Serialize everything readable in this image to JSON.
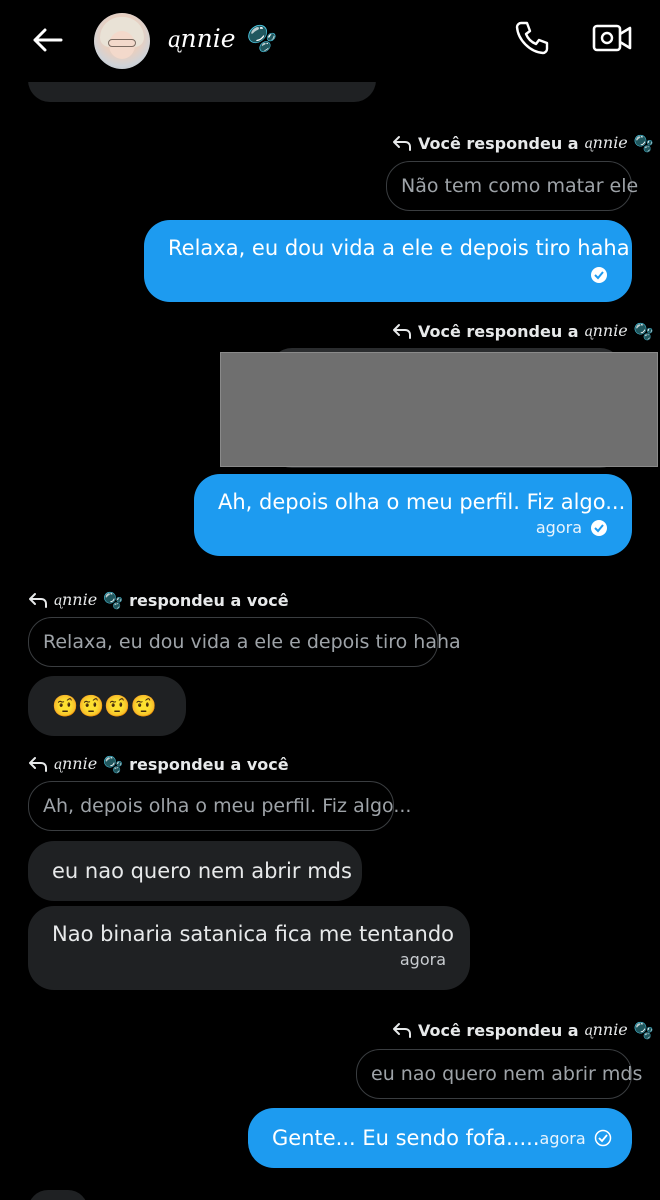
{
  "header": {
    "contact_name": "ᶏnnie",
    "contact_emoji": "🫧",
    "icons": [
      "back-arrow-icon",
      "phone-icon",
      "video-camera-icon"
    ]
  },
  "thread": {
    "reply1": {
      "label": "Você respondeu a",
      "name": "ᶏnnie",
      "emoji": "🫧",
      "quote": "Não tem como matar ele"
    },
    "msg1": {
      "text": "Relaxa, eu dou vida a ele e depois tiro haha"
    },
    "reply2": {
      "label": "Você respondeu a",
      "name": "ᶏnnie",
      "emoji": "🫧"
    },
    "msg2": {
      "text": "Ah, depois olha o meu perfil. Fiz algo...",
      "time": "agora"
    },
    "reply3": {
      "name": "ᶏnnie",
      "emoji": "🫧",
      "label": "respondeu a você",
      "quote": "Relaxa, eu dou vida a ele e depois tiro haha"
    },
    "msg3": {
      "text": "🤨🤨🤨🤨"
    },
    "reply4": {
      "name": "ᶏnnie",
      "emoji": "🫧",
      "label": "respondeu a você",
      "quote": "Ah, depois olha o meu perfil. Fiz algo..."
    },
    "msg4": {
      "text": "eu nao quero nem abrir mds"
    },
    "msg5": {
      "text": "Nao binaria satanica fica me tentando",
      "time": "agora"
    },
    "reply5": {
      "label": "Você respondeu a",
      "name": "ᶏnnie",
      "emoji": "🫧",
      "quote": "eu nao quero nem abrir mds"
    },
    "msg6": {
      "text": "Gente... Eu sendo fofa.....",
      "time": "agora"
    }
  },
  "colors": {
    "outgoing": "#1d9bf0",
    "incoming": "#1f2123",
    "background": "#000000"
  }
}
